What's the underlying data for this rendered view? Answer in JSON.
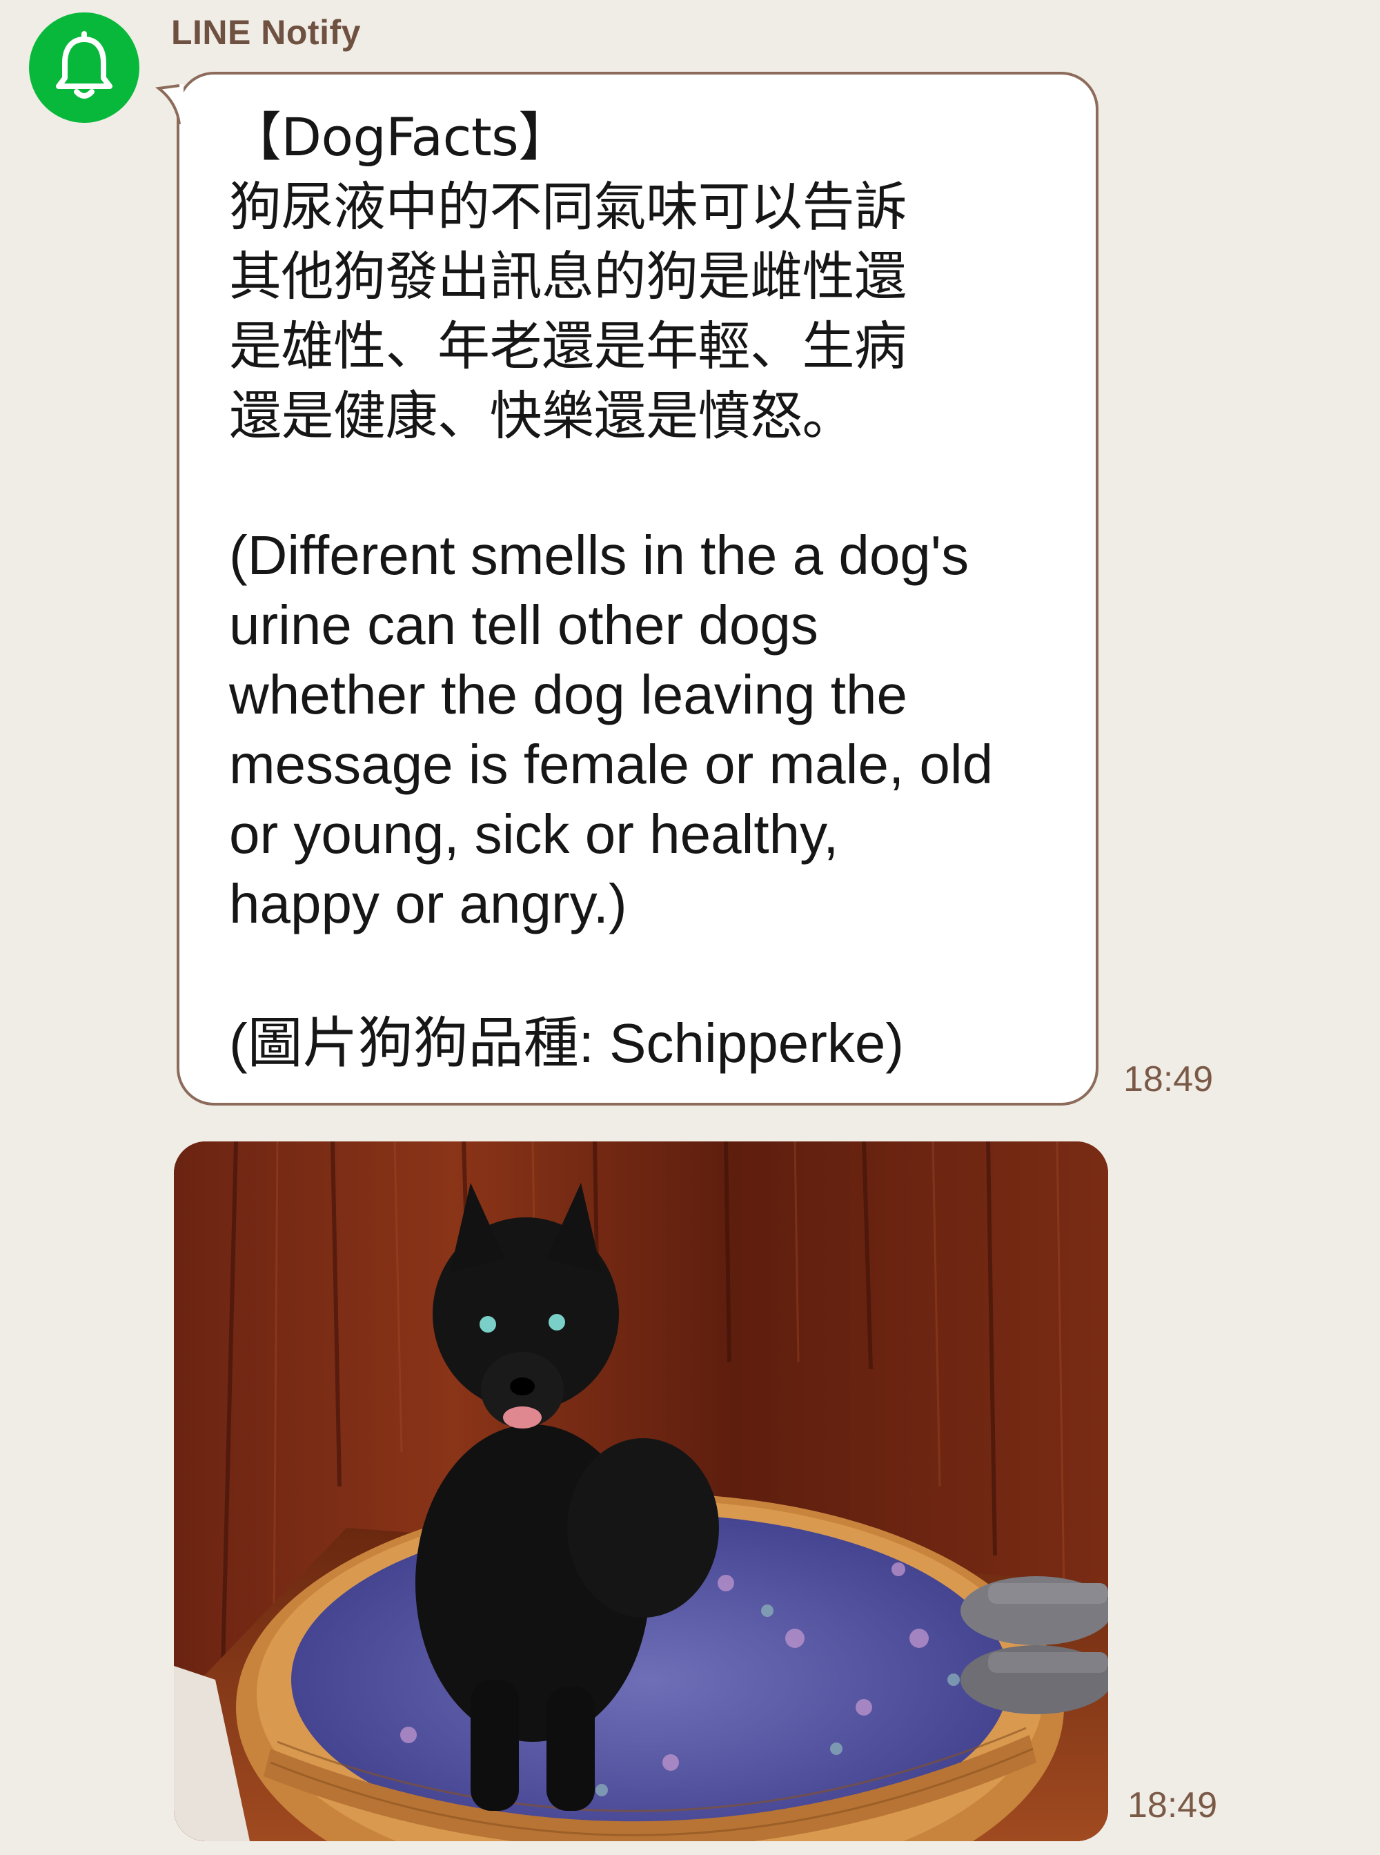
{
  "chat": {
    "sender_name": "LINE Notify",
    "avatar_icon": "bell-icon",
    "avatar_color": "#08b83b"
  },
  "message": {
    "lines": [
      "【DogFacts】",
      "狗尿液中的不同氣味可以告訴",
      "其他狗發出訊息的狗是雌性還",
      "是雄性、年老還是年輕、生病",
      "還是健康、快樂還是憤怒。",
      "",
      "(Different smells in the a dog's",
      "urine can tell other dogs",
      "whether the dog leaving the",
      "message is female or male, old",
      "or young, sick or healthy,",
      "happy or angry.)",
      "",
      "(圖片狗狗品種: Schipperke)"
    ],
    "time": "18:49"
  },
  "image_message": {
    "time": "18:49"
  }
}
